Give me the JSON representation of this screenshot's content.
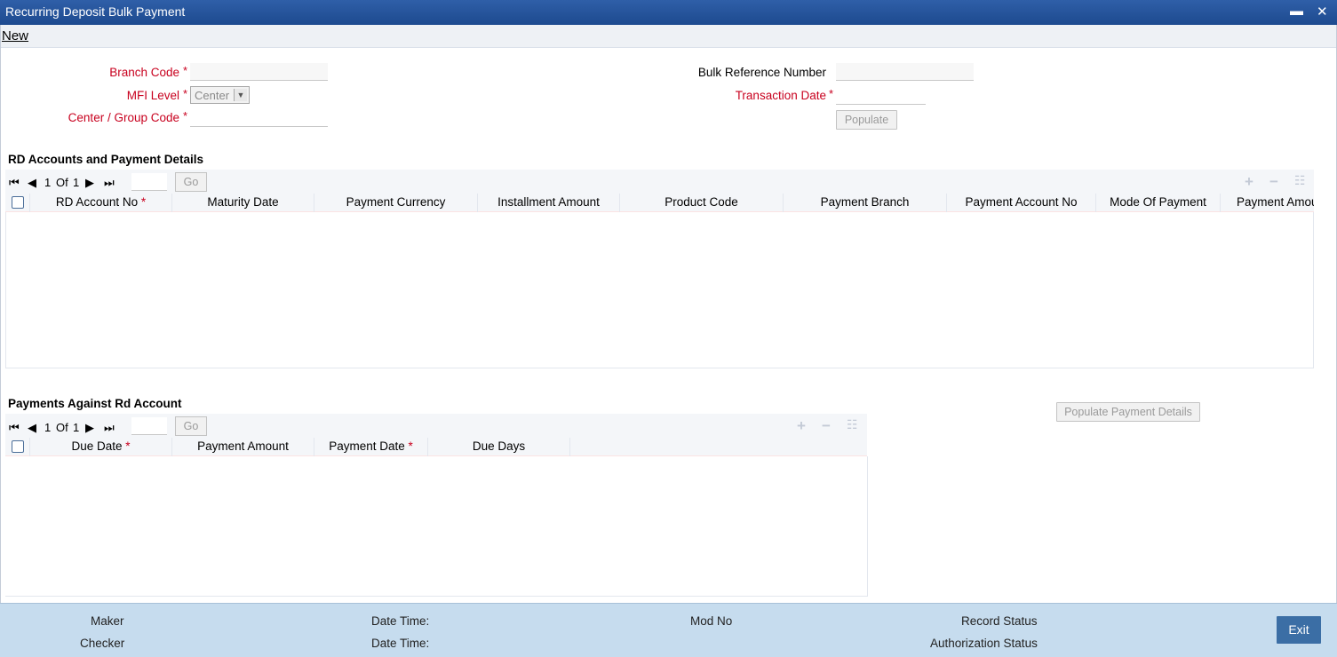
{
  "window": {
    "title": "Recurring Deposit Bulk Payment",
    "minimize": "▬",
    "close": "✕"
  },
  "menu": {
    "new_label": "New"
  },
  "form": {
    "branch_code_label": "Branch Code",
    "branch_code_value": "",
    "mfi_level_label": "MFI Level",
    "mfi_level_value": "Center",
    "center_group_label": "Center / Group Code",
    "center_group_value": "",
    "bulk_ref_label": "Bulk Reference Number",
    "bulk_ref_value": "",
    "txn_date_label": "Transaction Date",
    "txn_date_value": "",
    "populate_label": "Populate",
    "required_mark": "*"
  },
  "rd_section": {
    "title": "RD Accounts and Payment Details",
    "pager": {
      "current": "1",
      "of_label": "Of",
      "total": "1",
      "go_label": "Go"
    },
    "columns": [
      {
        "label": "RD Account No",
        "required": true
      },
      {
        "label": "Maturity Date",
        "required": false
      },
      {
        "label": "Payment Currency",
        "required": false
      },
      {
        "label": "Installment Amount",
        "required": false
      },
      {
        "label": "Product Code",
        "required": false
      },
      {
        "label": "Payment Branch",
        "required": false
      },
      {
        "label": "Payment Account No",
        "required": false
      },
      {
        "label": "Mode Of Payment",
        "required": false
      },
      {
        "label": "Payment Amou",
        "required": false
      }
    ],
    "rows": []
  },
  "payments_section": {
    "title": "Payments Against Rd Account",
    "populate_details_label": "Populate Payment Details",
    "pager": {
      "current": "1",
      "of_label": "Of",
      "total": "1",
      "go_label": "Go"
    },
    "columns": [
      {
        "label": "Due Date",
        "required": true
      },
      {
        "label": "Payment Amount",
        "required": false
      },
      {
        "label": "Payment Date",
        "required": true
      },
      {
        "label": "Due Days",
        "required": false
      }
    ],
    "rows": []
  },
  "toolbar_icons": {
    "add": "+",
    "remove": "−",
    "menu": "☷"
  },
  "pager_icons": {
    "first": "⏮",
    "prev": "◀",
    "next": "▶",
    "last": "⏭"
  },
  "footer": {
    "maker_label": "Maker",
    "checker_label": "Checker",
    "date_time_label_1": "Date Time:",
    "date_time_label_2": "Date Time:",
    "mod_no_label": "Mod No",
    "record_status_label": "Record Status",
    "auth_status_label": "Authorization Status",
    "exit_label": "Exit"
  },
  "colors": {
    "titlebar": "#2f5fa8",
    "required_red": "#c8001e",
    "footer_bg": "#c6dcee",
    "exit_button": "#3b6ea5"
  }
}
